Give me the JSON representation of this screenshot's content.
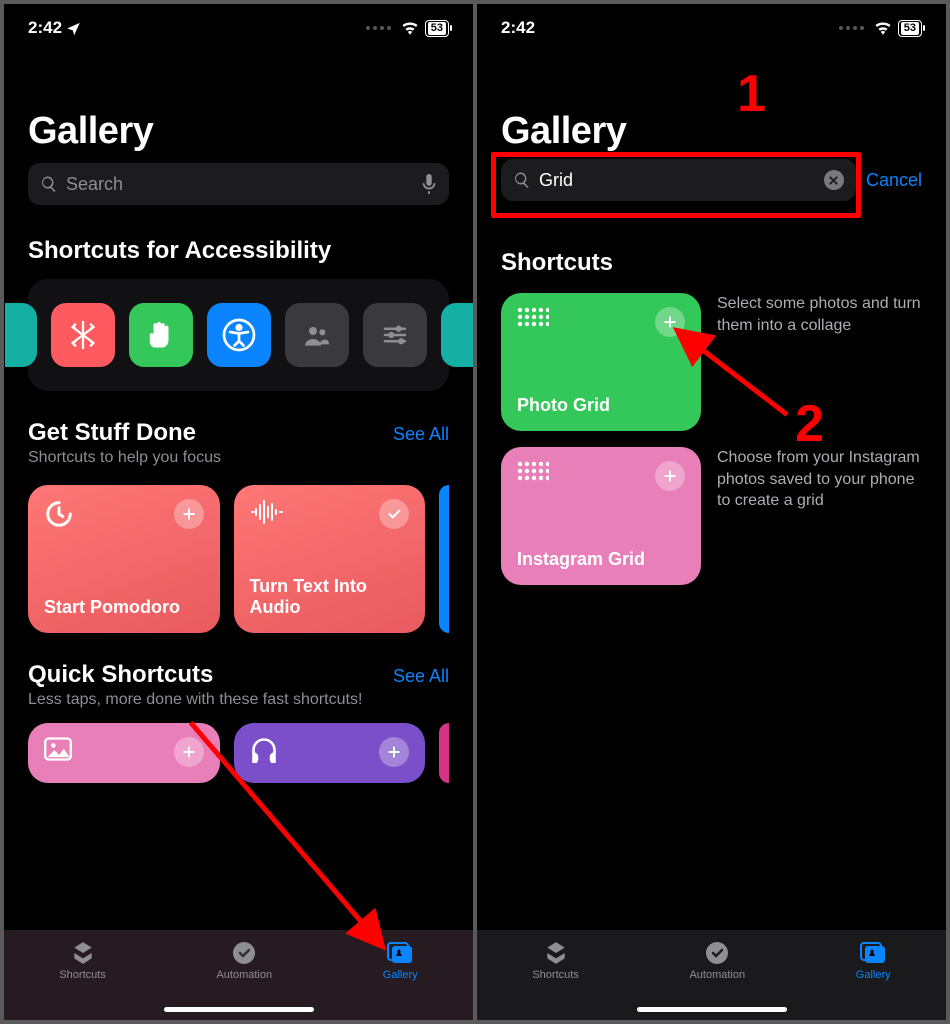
{
  "status": {
    "time": "2:42",
    "battery": "53"
  },
  "left": {
    "title": "Gallery",
    "search_placeholder": "Search",
    "section1": {
      "title": "Shortcuts for Accessibility"
    },
    "section2": {
      "title": "Get Stuff Done",
      "subtitle": "Shortcuts to help you focus",
      "see_all": "See All"
    },
    "cards2": [
      {
        "label": "Start Pomodoro"
      },
      {
        "label": "Turn Text Into Audio"
      }
    ],
    "section3": {
      "title": "Quick Shortcuts",
      "subtitle": "Less taps, more done with these fast shortcuts!",
      "see_all": "See All"
    },
    "tabs": {
      "shortcuts": "Shortcuts",
      "automation": "Automation",
      "gallery": "Gallery"
    }
  },
  "right": {
    "title": "Gallery",
    "search_value": "Grid",
    "cancel": "Cancel",
    "section": "Shortcuts",
    "results": [
      {
        "label": "Photo Grid",
        "desc": "Select some photos and turn them into a collage",
        "color": "#34c759"
      },
      {
        "label": "Instagram Grid",
        "desc": "Choose from your Instagram photos saved to your phone to create a grid",
        "color": "#e87fb9"
      }
    ],
    "tabs": {
      "shortcuts": "Shortcuts",
      "automation": "Automation",
      "gallery": "Gallery"
    }
  },
  "annotations": {
    "one": "1",
    "two": "2"
  }
}
